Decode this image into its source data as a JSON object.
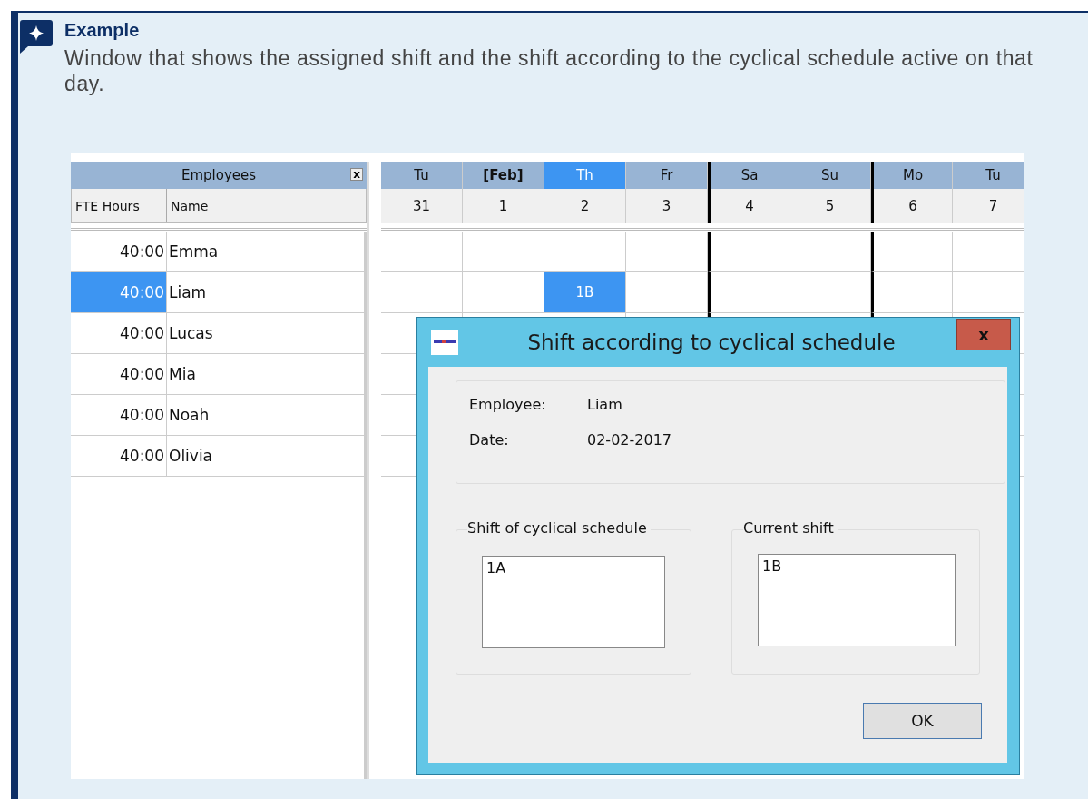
{
  "callout": {
    "title": "Example",
    "text": "Window that shows the assigned shift and the shift according to the cyclical schedule active on that day."
  },
  "employees_panel": {
    "title": "Employees",
    "close_label": "x",
    "columns": [
      "FTE Hours",
      "Name"
    ],
    "rows": [
      {
        "fte": "40:00",
        "name": "Emma",
        "selected": false,
        "day_cells": [
          {
            "selected": false
          },
          {
            "selected": false
          },
          {
            "selected": false
          },
          {
            "selected": false
          },
          {
            "selected": false
          },
          {
            "selected": false
          },
          {
            "selected": false
          },
          {
            "selected": false
          }
        ]
      },
      {
        "fte": "40:00",
        "name": "Liam",
        "selected": true,
        "day_cells": [
          {
            "selected": false
          },
          {
            "selected": false
          },
          {
            "text": "1B",
            "selected": true
          },
          {
            "selected": false
          },
          {
            "selected": false
          },
          {
            "selected": false
          },
          {
            "selected": false
          },
          {
            "selected": false
          }
        ]
      },
      {
        "fte": "40:00",
        "name": "Lucas",
        "selected": false
      },
      {
        "fte": "40:00",
        "name": "Mia",
        "selected": false
      },
      {
        "fte": "40:00",
        "name": "Noah",
        "selected": false
      },
      {
        "fte": "40:00",
        "name": "Olivia",
        "selected": false
      }
    ]
  },
  "calendar": {
    "days": [
      {
        "weekday": "Tu",
        "date": "31",
        "selected": false,
        "month_start": false,
        "week_separator": false
      },
      {
        "weekday": "[Feb]",
        "date": "1",
        "selected": false,
        "month_start": true,
        "week_separator": false
      },
      {
        "weekday": "Th",
        "date": "2",
        "selected": true,
        "month_start": false,
        "week_separator": false
      },
      {
        "weekday": "Fr",
        "date": "3",
        "selected": false,
        "month_start": false,
        "week_separator": false
      },
      {
        "weekday": "Sa",
        "date": "4",
        "selected": false,
        "month_start": false,
        "week_separator": true
      },
      {
        "weekday": "Su",
        "date": "5",
        "selected": false,
        "month_start": false,
        "week_separator": false
      },
      {
        "weekday": "Mo",
        "date": "6",
        "selected": false,
        "month_start": false,
        "week_separator": true
      },
      {
        "weekday": "Tu",
        "date": "7",
        "selected": false,
        "month_start": false,
        "week_separator": false
      }
    ]
  },
  "dialog": {
    "title": "Shift according to cyclical schedule",
    "close_label": "x",
    "info": [
      {
        "label": "Employee:",
        "value": "Liam"
      },
      {
        "label": "Date:",
        "value": "02-02-2017"
      }
    ],
    "groups": [
      {
        "label": "Shift of cyclical schedule",
        "value": "1A"
      },
      {
        "label": "Current shift",
        "value": "1B"
      }
    ],
    "ok_button": "OK"
  }
}
